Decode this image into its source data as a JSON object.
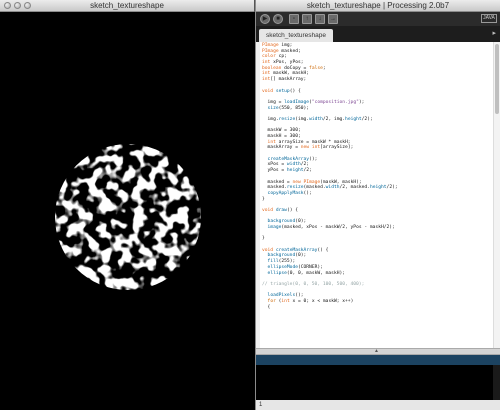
{
  "sketch_window": {
    "title": "sketch_textureshape"
  },
  "ide_window": {
    "title": "sketch_textureshape | Processing 2.0b7",
    "mode": "JAVA",
    "toolbar": [
      "run-icon",
      "stop-icon",
      "new-icon",
      "open-icon",
      "save-icon",
      "export-icon"
    ],
    "tab": "sketch_textureshape",
    "code_lines": [
      "PImage img;",
      "PImage masked;",
      "color cp;",
      "int xPos, yPos;",
      "boolean doCopy = false;",
      "int maskW, maskH;",
      "int[] maskArray;",
      "",
      "void setup() {",
      "",
      "  img = loadImage(\"composition.jpg\");",
      "  size(550, 850);",
      "",
      "  img.resize(img.width/2, img.height/2);",
      "",
      "  maskW = 300;",
      "  maskH = 300;",
      "  int arraySize = maskW * maskH;",
      "  maskArray = new int[arraySize];",
      "",
      "  createMaskArray();",
      "  xPos = width/2;",
      "  yPos = height/2;",
      "",
      "  masked = new PImage(maskW, maskH);",
      "  masked.resize(masked.width/2, masked.height/2);",
      "  copyApplyMask();",
      "}",
      "",
      "void draw() {",
      "",
      "  background(0);",
      "  image(masked, xPos - maskW/2, yPos - maskH/2);",
      "",
      "}",
      "",
      "void createMaskArray() {",
      "  background(0);",
      "  fill(255);",
      "  ellipseMode(CORNER);",
      "  ellipse(0, 0, maskW, maskH);",
      "",
      "// triangle(0, 0, 50, 100, 500, 400);",
      "",
      "  loadPixels();",
      "  for (int x = 0; x < maskW; x++)",
      "  {"
    ],
    "status_line": "1"
  },
  "colors": {
    "keyword": "#cc6600",
    "type": "#e2661a",
    "function": "#006699",
    "string": "#7d4793",
    "comment": "#95a5a6",
    "message_area": "#1c4361",
    "console": "#000000"
  }
}
